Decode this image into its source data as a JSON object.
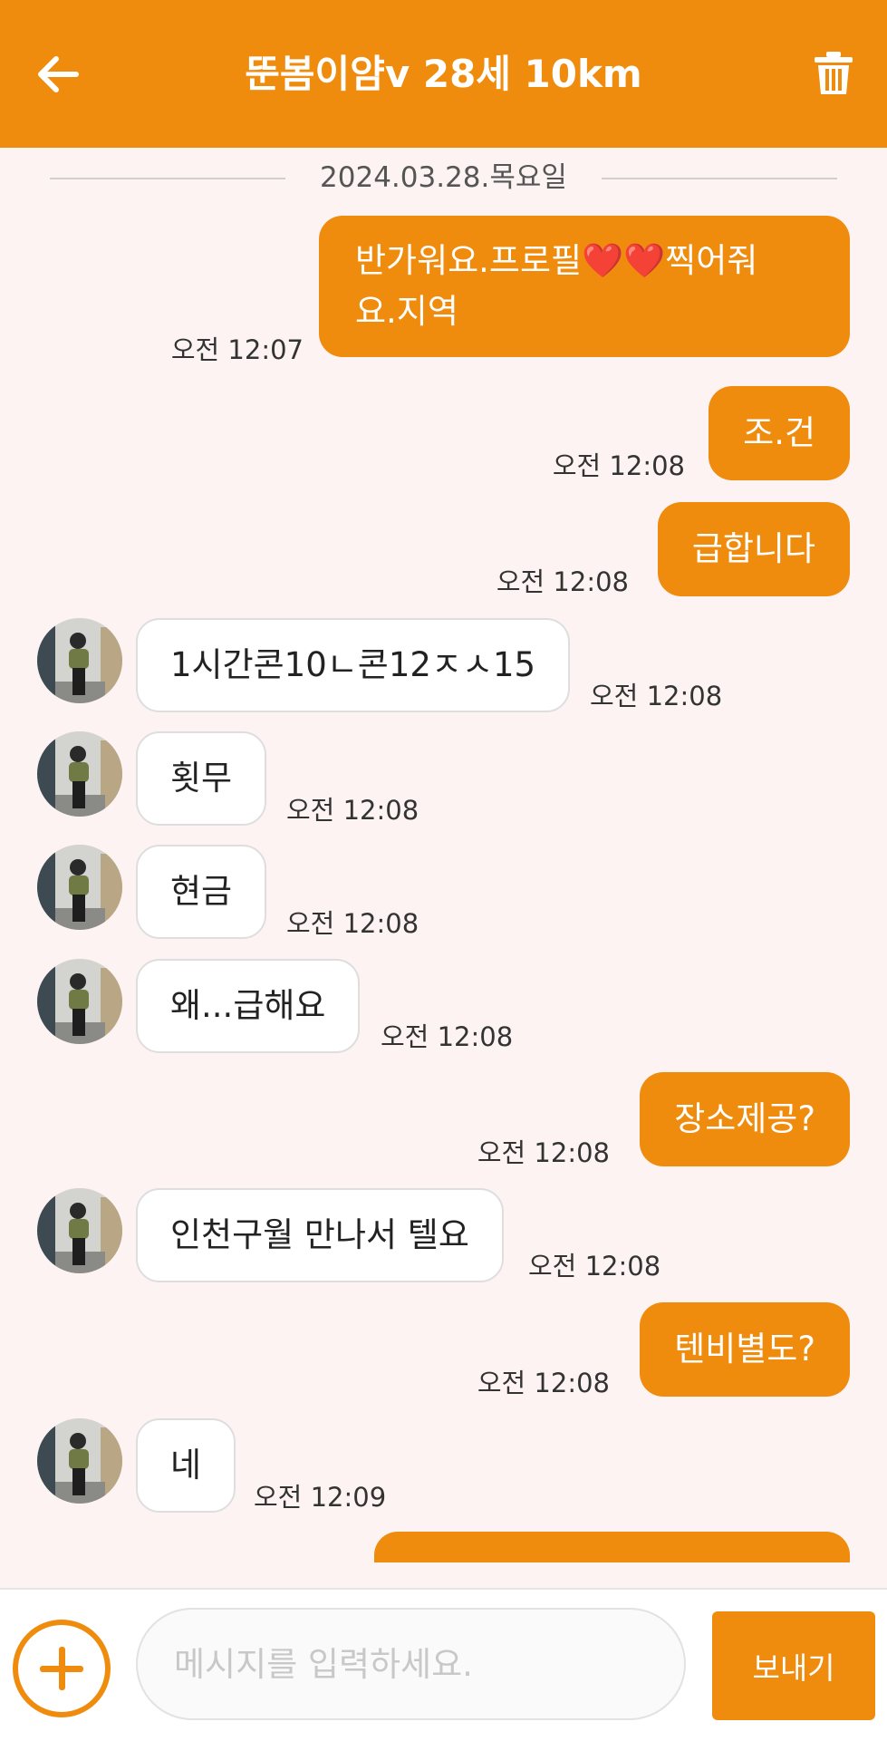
{
  "header": {
    "title": "뚠봄이얌v 28세 10km",
    "back_icon": "arrow-left-icon",
    "delete_icon": "trash-icon"
  },
  "date_separator": "2024.03.28.목요일",
  "messages": [
    {
      "from": "me",
      "lines": [
        "반가워요.프로필❤️❤️찍어줘",
        "요.지역"
      ],
      "time": "오전 12:07"
    },
    {
      "from": "me",
      "text": "조.건",
      "time": "오전 12:08"
    },
    {
      "from": "me",
      "text": "급합니다",
      "time": "오전 12:08"
    },
    {
      "from": "them",
      "text": "1시간콘10ㄴ콘12ㅈㅅ15",
      "time": "오전 12:08"
    },
    {
      "from": "them",
      "text": "횟무",
      "time": "오전 12:08"
    },
    {
      "from": "them",
      "text": "현금",
      "time": "오전 12:08"
    },
    {
      "from": "them",
      "text": "왜...급해요",
      "time": "오전 12:08"
    },
    {
      "from": "me",
      "text": "장소제공?",
      "time": "오전 12:08"
    },
    {
      "from": "them",
      "text": "인천구월 만나서 텔요",
      "time": "오전 12:08"
    },
    {
      "from": "me",
      "text": "텐비별도?",
      "time": "오전 12:08"
    },
    {
      "from": "them",
      "text": "네",
      "time": "오전 12:09"
    }
  ],
  "composer": {
    "add_icon": "plus-circle-icon",
    "placeholder": "메시지를 입력하세요.",
    "send_label": "보내기"
  },
  "colors": {
    "accent": "#ef8c0e",
    "background": "#fdf3f3"
  }
}
